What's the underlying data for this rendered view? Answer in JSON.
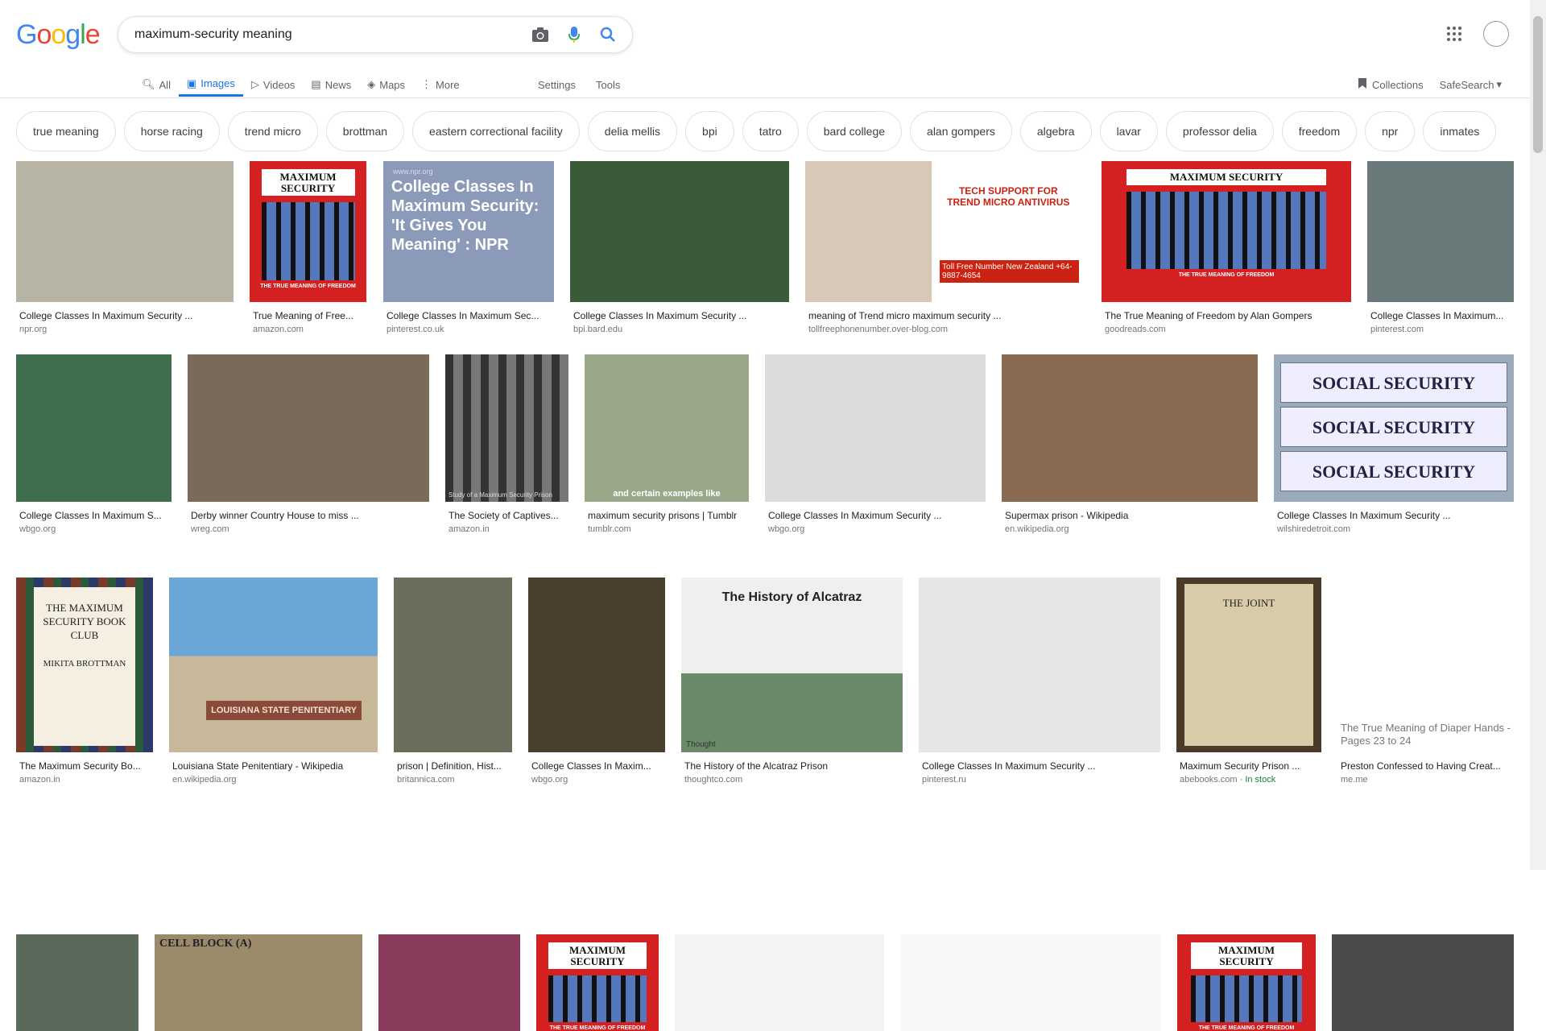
{
  "logo": {
    "letters": [
      "G",
      "o",
      "o",
      "g",
      "l",
      "e"
    ],
    "colors": [
      "#4285F4",
      "#EA4335",
      "#FBBC05",
      "#4285F4",
      "#34A853",
      "#EA4335"
    ]
  },
  "search": {
    "query": "maximum-security meaning"
  },
  "tabs": [
    {
      "label": "All",
      "icon": "search-icon"
    },
    {
      "label": "Images",
      "icon": "image-icon"
    },
    {
      "label": "Videos",
      "icon": "video-icon"
    },
    {
      "label": "News",
      "icon": "news-icon"
    },
    {
      "label": "Maps",
      "icon": "map-icon"
    },
    {
      "label": "More",
      "icon": "more-vert-icon"
    }
  ],
  "tools": {
    "settings": "Settings",
    "tools": "Tools",
    "collections": "Collections",
    "safesearch": "SafeSearch"
  },
  "chips": [
    "true meaning",
    "horse racing",
    "trend micro",
    "brottman",
    "eastern correctional facility",
    "delia mellis",
    "bpi",
    "tatro",
    "bard college",
    "alan gompers",
    "algebra",
    "lavar",
    "professor delia",
    "freedom",
    "npr",
    "inmates"
  ],
  "results": [
    {
      "caption": "College Classes In Maximum Security ...",
      "source": "npr.org"
    },
    {
      "caption": "True Meaning of Free...",
      "source": "amazon.com"
    },
    {
      "caption": "College Classes In Maximum Sec...",
      "source": "pinterest.co.uk"
    },
    {
      "caption": "College Classes In Maximum Security ...",
      "source": "bpi.bard.edu"
    },
    {
      "caption": "meaning of Trend micro maximum security ...",
      "source": "tollfreephonenumber.over-blog.com"
    },
    {
      "caption": "The True Meaning of Freedom by Alan Gompers",
      "source": "goodreads.com"
    },
    {
      "caption": "College Classes In Maximum...",
      "source": "pinterest.com"
    },
    {
      "caption": "College Classes In Maximum S...",
      "source": "wbgo.org"
    },
    {
      "caption": "Derby winner Country House to miss ...",
      "source": "wreg.com"
    },
    {
      "caption": "The Society of Captives...",
      "source": "amazon.in"
    },
    {
      "caption": "maximum security prisons | Tumblr",
      "source": "tumblr.com"
    },
    {
      "caption": "College Classes In Maximum Security ...",
      "source": "wbgo.org"
    },
    {
      "caption": "Supermax prison - Wikipedia",
      "source": "en.wikipedia.org"
    },
    {
      "caption": "College Classes In Maximum Security ...",
      "source": "wilshiredetroit.com"
    },
    {
      "caption": "The Maximum Security Bo...",
      "source": "amazon.in"
    },
    {
      "caption": "Louisiana State Penitentiary - Wikipedia",
      "source": "en.wikipedia.org"
    },
    {
      "caption": "prison | Definition, Hist...",
      "source": "britannica.com"
    },
    {
      "caption": "College Classes In Maxim...",
      "source": "wbgo.org"
    },
    {
      "caption": "The History of the Alcatraz Prison",
      "source": "thoughtco.com"
    },
    {
      "caption": "College Classes In Maximum Security ...",
      "source": "pinterest.ru"
    },
    {
      "caption": "Maximum Security Prison ...",
      "source": "abebooks.com",
      "badge": "In stock"
    },
    {
      "caption": "Preston Confessed to Having Creat...",
      "source": "me.me"
    }
  ],
  "thumb_text": {
    "npr_title": "College Classes In Maximum Security: 'It Gives You Meaning' : NPR",
    "npr_url": "www.npr.org",
    "book_title": "MAXIMUM SECURITY",
    "book_sub": "THE TRUE MEANING OF FREEDOM",
    "trend_title": "TECH SUPPORT FOR TREND MICRO ANTIVIRUS",
    "trend_phone": "Toll Free Number New Zealand +64-9887-4654",
    "social": "SOCIAL SECURITY",
    "alcatraz": "The History of Alcatraz",
    "club": "THE MAXIMUM SECURITY BOOK CLUB",
    "club_author": "MIKITA BROTTMAN",
    "joint": "THE JOINT",
    "diaper": "The True Meaning of Diaper Hands - Pages 23 to 24",
    "captives": "Study of a Maximum Security Prison",
    "tumblr_sub": "and certain examples like",
    "louisiana": "LOUISIANA STATE PENITENTIARY",
    "cell_block": "CELL BLOCK (A)",
    "thoughtco": "Thought"
  }
}
